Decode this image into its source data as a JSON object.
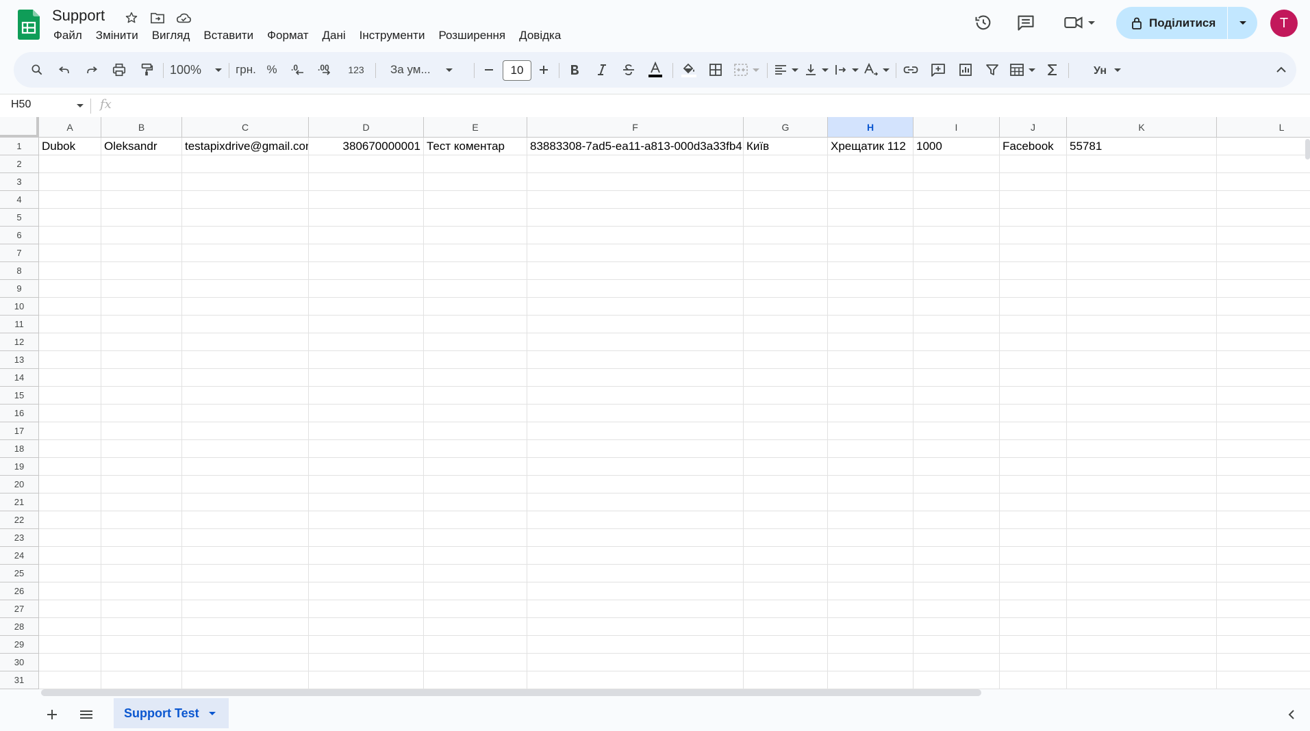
{
  "app": {
    "doc_title": "Support",
    "menu": [
      "Файл",
      "Змінити",
      "Вигляд",
      "Вставити",
      "Формат",
      "Дані",
      "Інструменти",
      "Розширення",
      "Довідка"
    ],
    "share_label": "Поділитися",
    "avatar_letter": "T"
  },
  "toolbar": {
    "zoom": "100%",
    "currency": "грн.",
    "percent": "%",
    "decrease_decimal": ".0",
    "increase_decimal": ".00",
    "more_formats": "123",
    "font": "За ум...",
    "font_size": "10"
  },
  "formula_bar": {
    "name_box": "H50",
    "fx": "fx"
  },
  "grid": {
    "columns": [
      "A",
      "B",
      "C",
      "D",
      "E",
      "F",
      "G",
      "H",
      "I",
      "J",
      "K",
      "L"
    ],
    "selected_column": "H",
    "rows": [
      "1",
      "2",
      "3",
      "4",
      "5",
      "6",
      "7",
      "8",
      "9",
      "10",
      "11",
      "12",
      "13",
      "14",
      "15",
      "16",
      "17",
      "18",
      "19",
      "20",
      "21",
      "22",
      "23",
      "24",
      "25",
      "26",
      "27",
      "28",
      "29",
      "30",
      "31"
    ],
    "row1": [
      "Dubok",
      "Oleksandr",
      "testapixdrive@gmail.con",
      "380670000001",
      "Тест коментар",
      "83883308-7ad5-ea11-a813-000d3a33fb4",
      "Київ",
      "Хрещатик 112",
      "1000",
      "Facebook",
      "55781"
    ]
  },
  "sheets": {
    "active_tab": "Support Test"
  },
  "colors": {
    "accent": "#0b57d0",
    "share_bg": "#c2e7ff",
    "avatar_bg": "#c2185b",
    "selected_header": "#d3e3fd"
  }
}
